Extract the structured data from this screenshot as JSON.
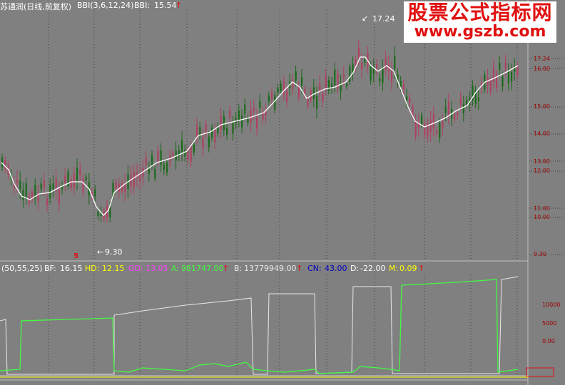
{
  "main_header": {
    "title": "苏通润(日线,前复权)",
    "indicator": "BBI(3,6,12,24)",
    "bbi_label": "BBI:",
    "bbi_value": "15.54",
    "arrow": "↑"
  },
  "annotations": {
    "high": "17.24",
    "low": "9.30",
    "marker": "5"
  },
  "price_axis": [
    "17.24",
    "16.00",
    "15.00",
    "14.00",
    "13.00",
    "12.00",
    "11.00",
    "10.00",
    "9.30"
  ],
  "sub_header": {
    "params": "(50,55,25)",
    "bf_label": "BF:",
    "bf_value": "16.15",
    "hd_label": "HD:",
    "hd_value": "12.15",
    "gd_label": "GD:",
    "gd_value": "13.05",
    "a_label": "A:",
    "a_value": "981747.00",
    "b_label": "B:",
    "b_value": "13779949.00",
    "cn_label": "CN:",
    "cn_value": "43.00",
    "d_label": "D:",
    "d_value": "-22.00",
    "m_label": "M:",
    "m_value": "0.09",
    "arrow": "↑"
  },
  "sub_axis": [
    "10000",
    "5000",
    "0.00"
  ],
  "watermark": {
    "line1": "股票公式指标网",
    "line2": "www.gszb.com"
  },
  "colors": {
    "background": "#808080",
    "bull": "#b04060",
    "bear": "#1a6a1a",
    "bbi_line": "#ffffff",
    "green_line": "#40ff40",
    "white_line": "#e8e8e8",
    "yellow": "#ffff00",
    "blue": "#0000c0",
    "magenta": "#ff40ff",
    "accent_red": "#e01010"
  }
}
